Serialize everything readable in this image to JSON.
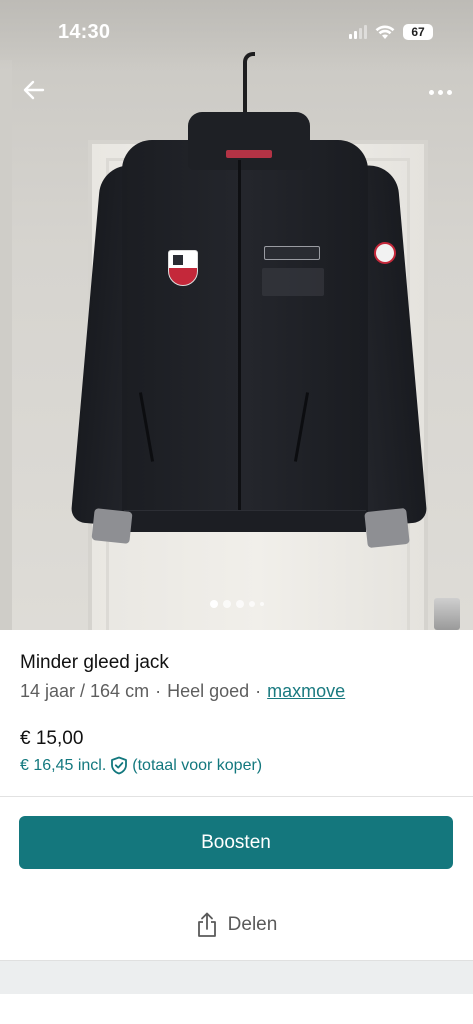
{
  "status_bar": {
    "time": "14:30",
    "battery": "67"
  },
  "photo": {
    "alt": "Minder gleed jack foto",
    "total_images": 5,
    "active_image_index": 0
  },
  "navigation": {
    "back_icon": "arrow-left-icon",
    "more_icon": "more-horizontal-icon"
  },
  "listing": {
    "title": "Minder gleed jack",
    "size": "14 jaar / 164 cm",
    "separator": "·",
    "condition": "Heel goed",
    "brand": "maxmove",
    "price": "€ 15,00",
    "price_incl": "€ 16,45 incl.",
    "price_incl_note": "(totaal voor koper)",
    "shield_icon": "shield-check-icon"
  },
  "actions": {
    "boost_label": "Boosten",
    "share_label": "Delen",
    "share_icon": "share-icon"
  },
  "colors": {
    "accent": "#14777d",
    "link": "#1a7a80",
    "muted_text": "#5e5e5e"
  }
}
